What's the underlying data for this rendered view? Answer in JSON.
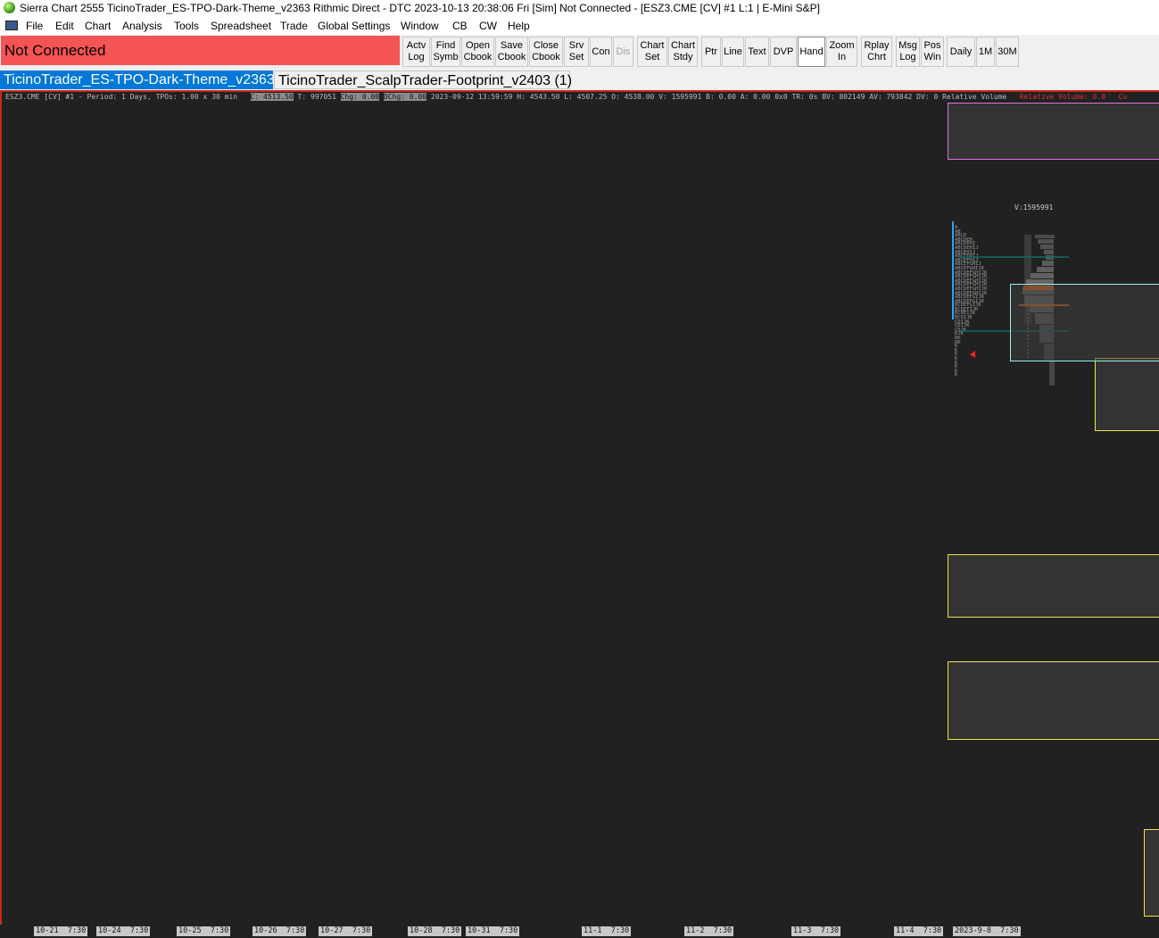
{
  "window": {
    "title": "Sierra Chart 2555 TicinoTrader_ES-TPO-Dark-Theme_v2363 Rithmic Direct - DTC 2023-10-13  20:38:06 Fri [Sim]  Not Connected - [ESZ3.CME [CV] #1 L:1 | E-Mini S&P]"
  },
  "menu": [
    "File",
    "Edit",
    "Chart",
    "Analysis",
    "Tools",
    "Spreadsheet",
    "Trade",
    "Global Settings",
    "Window",
    "CB",
    "CW",
    "Help"
  ],
  "status": {
    "connection": "Not Connected",
    "color": "#f45454"
  },
  "toolbar": {
    "buttons": [
      {
        "label": "Actv\nLog"
      },
      {
        "label": "Find\nSymb"
      },
      {
        "label": "Open\nCbook"
      },
      {
        "label": "Save\nCbook"
      },
      {
        "label": "Close\nCbook"
      },
      {
        "label": "Srv\nSet"
      },
      {
        "label": "Con"
      },
      {
        "label": "Dis"
      },
      {
        "label": "Chart\nSet"
      },
      {
        "label": "Chart\nStdy"
      },
      {
        "label": "Ptr"
      },
      {
        "label": "Line"
      },
      {
        "label": "Text"
      },
      {
        "label": "DVP"
      },
      {
        "label": "Hand"
      },
      {
        "label": "Zoom\nIn"
      },
      {
        "label": "Rplay\nChrt"
      },
      {
        "label": "Msg\nLog"
      },
      {
        "label": "Pos\nWin"
      },
      {
        "label": "Daily"
      },
      {
        "label": "1M"
      },
      {
        "label": "30M"
      }
    ]
  },
  "tabs": [
    {
      "label": "TicinoTrader_ES-TPO-Dark-Theme_v2363",
      "selected": true
    },
    {
      "label": "TicinoTrader_ScalpTrader-Footprint_v2403 (1)",
      "selected": false
    }
  ],
  "chart": {
    "info_prefix": "ESZ3.CME [CV] #1 - Period: 1 Days, TPOs: 1.00 x 30 min",
    "info_close": "C: 4513.50",
    "info_trades": "T: 997051",
    "info_chg": "Chg: 0.00",
    "info_dchg": "DChg: 0.00",
    "info_rest": "2023-09-12 13:59:59 H: 4543.50 L: 4507.25 O: 4538.00 V: 1595991 B: 0.00 A: 0.00 0x0 TR: 0s BV: 802149 AV: 793842 DV: 0 Relative Volume",
    "info_relvol": "Relative Volume: 0.0",
    "info_tail": "Cu",
    "volume_label": "V:1595991",
    "x_axis_ticks": [
      "10-21  7:30",
      "10-24  7:30",
      "10-25  7:30",
      "10-26  7:30",
      "10-27  7:30",
      "10-28  7:30",
      "10-31  7:30",
      "11-1  7:30",
      "11-2  7:30",
      "11-3  7:30",
      "11-4  7:30",
      "2023-9-8  7:30"
    ]
  }
}
